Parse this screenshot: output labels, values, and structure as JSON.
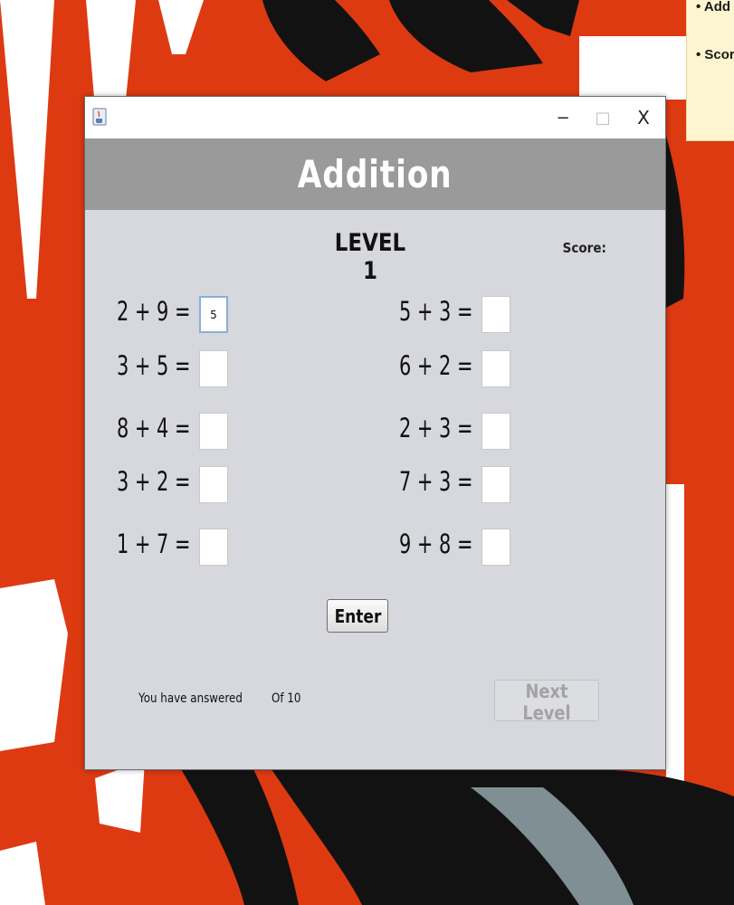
{
  "desktop": {
    "colors": {
      "background": "#dd3a12",
      "ink": "#121212",
      "paper": "#ffffff"
    },
    "note": {
      "lines": [
        "• Add",
        "• Score"
      ]
    }
  },
  "window": {
    "icon": "java-cup-icon",
    "controls": {
      "minimize": "−",
      "maximize": "□",
      "close": "X"
    },
    "banner_title": "Addition",
    "level_title": "LEVEL 1",
    "score_label": "Score:",
    "problems": [
      {
        "label": "2 + 9 =",
        "answer": "5"
      },
      {
        "label": "3 + 5 =",
        "answer": ""
      },
      {
        "label": "8 + 4 =",
        "answer": ""
      },
      {
        "label": "3 + 2 =",
        "answer": ""
      },
      {
        "label": "1 + 7 =",
        "answer": ""
      },
      {
        "label": "5 + 3 =",
        "answer": ""
      },
      {
        "label": "6 + 2 =",
        "answer": ""
      },
      {
        "label": "2 + 3 =",
        "answer": ""
      },
      {
        "label": "7 + 3 =",
        "answer": ""
      },
      {
        "label": "9 + 8 =",
        "answer": ""
      }
    ],
    "enter_label": "Enter",
    "answered_label": "You have answered",
    "of_label": "Of 10",
    "next_level_label": "Next Level",
    "colors": {
      "banner": "#9a9a9a",
      "panel": "#d7d8de",
      "focus": "#8aaed6"
    }
  }
}
